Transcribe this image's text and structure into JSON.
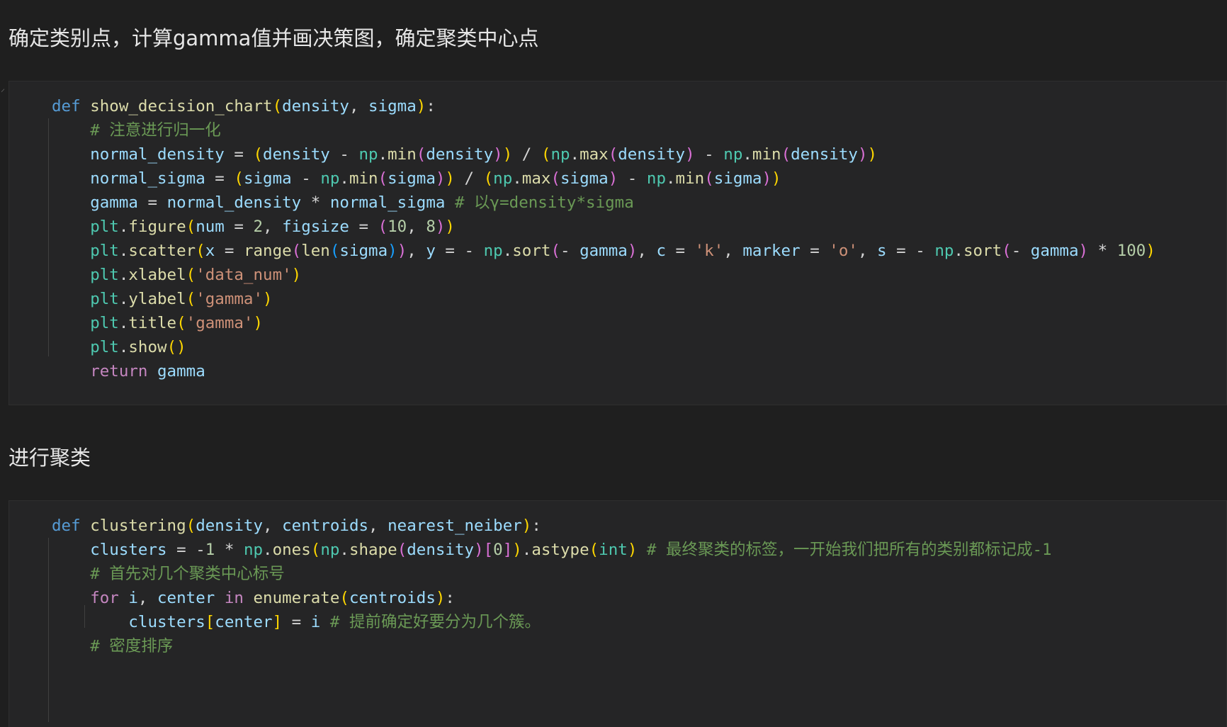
{
  "headings": {
    "first": "确定类别点，计算gamma值并画决策图，确定聚类中心点",
    "second": "进行聚类"
  },
  "cell1": {
    "lines": [
      [
        [
          "kw",
          "def"
        ],
        [
          "op",
          " "
        ],
        [
          "fn",
          "show_decision_chart"
        ],
        [
          "b1",
          "("
        ],
        [
          "var",
          "density"
        ],
        [
          "op",
          ", "
        ],
        [
          "var",
          "sigma"
        ],
        [
          "b1",
          ")"
        ],
        [
          "op",
          ":"
        ]
      ],
      [
        [
          "op",
          "    "
        ],
        [
          "cm",
          "# 注意进行归一化"
        ]
      ],
      [
        [
          "op",
          "    "
        ],
        [
          "var",
          "normal_density"
        ],
        [
          "op",
          " = "
        ],
        [
          "b1",
          "("
        ],
        [
          "var",
          "density"
        ],
        [
          "op",
          " - "
        ],
        [
          "mod",
          "np"
        ],
        [
          "op",
          "."
        ],
        [
          "fn",
          "min"
        ],
        [
          "b2",
          "("
        ],
        [
          "var",
          "density"
        ],
        [
          "b2",
          ")"
        ],
        [
          "b1",
          ")"
        ],
        [
          "op",
          " / "
        ],
        [
          "b1",
          "("
        ],
        [
          "mod",
          "np"
        ],
        [
          "op",
          "."
        ],
        [
          "fn",
          "max"
        ],
        [
          "b2",
          "("
        ],
        [
          "var",
          "density"
        ],
        [
          "b2",
          ")"
        ],
        [
          "op",
          " - "
        ],
        [
          "mod",
          "np"
        ],
        [
          "op",
          "."
        ],
        [
          "fn",
          "min"
        ],
        [
          "b2",
          "("
        ],
        [
          "var",
          "density"
        ],
        [
          "b2",
          ")"
        ],
        [
          "b1",
          ")"
        ]
      ],
      [
        [
          "op",
          "    "
        ],
        [
          "var",
          "normal_sigma"
        ],
        [
          "op",
          " = "
        ],
        [
          "b1",
          "("
        ],
        [
          "var",
          "sigma"
        ],
        [
          "op",
          " - "
        ],
        [
          "mod",
          "np"
        ],
        [
          "op",
          "."
        ],
        [
          "fn",
          "min"
        ],
        [
          "b2",
          "("
        ],
        [
          "var",
          "sigma"
        ],
        [
          "b2",
          ")"
        ],
        [
          "b1",
          ")"
        ],
        [
          "op",
          " / "
        ],
        [
          "b1",
          "("
        ],
        [
          "mod",
          "np"
        ],
        [
          "op",
          "."
        ],
        [
          "fn",
          "max"
        ],
        [
          "b2",
          "("
        ],
        [
          "var",
          "sigma"
        ],
        [
          "b2",
          ")"
        ],
        [
          "op",
          " - "
        ],
        [
          "mod",
          "np"
        ],
        [
          "op",
          "."
        ],
        [
          "fn",
          "min"
        ],
        [
          "b2",
          "("
        ],
        [
          "var",
          "sigma"
        ],
        [
          "b2",
          ")"
        ],
        [
          "b1",
          ")"
        ]
      ],
      [
        [
          "op",
          "    "
        ],
        [
          "var",
          "gamma"
        ],
        [
          "op",
          " = "
        ],
        [
          "var",
          "normal_density"
        ],
        [
          "op",
          " * "
        ],
        [
          "var",
          "normal_sigma"
        ],
        [
          "op",
          " "
        ],
        [
          "cm",
          "# 以γ=density*sigma"
        ]
      ],
      [
        [
          "op",
          "    "
        ],
        [
          "mod",
          "plt"
        ],
        [
          "op",
          "."
        ],
        [
          "fn",
          "figure"
        ],
        [
          "b1",
          "("
        ],
        [
          "var",
          "num"
        ],
        [
          "op",
          " = "
        ],
        [
          "num",
          "2"
        ],
        [
          "op",
          ", "
        ],
        [
          "var",
          "figsize"
        ],
        [
          "op",
          " = "
        ],
        [
          "b2",
          "("
        ],
        [
          "num",
          "10"
        ],
        [
          "op",
          ", "
        ],
        [
          "num",
          "8"
        ],
        [
          "b2",
          ")"
        ],
        [
          "b1",
          ")"
        ]
      ],
      [
        [
          "op",
          "    "
        ],
        [
          "mod",
          "plt"
        ],
        [
          "op",
          "."
        ],
        [
          "fn",
          "scatter"
        ],
        [
          "b1",
          "("
        ],
        [
          "var",
          "x"
        ],
        [
          "op",
          " = "
        ],
        [
          "fn",
          "range"
        ],
        [
          "b2",
          "("
        ],
        [
          "fn",
          "len"
        ],
        [
          "b3",
          "("
        ],
        [
          "var",
          "sigma"
        ],
        [
          "b3",
          ")"
        ],
        [
          "b2",
          ")"
        ],
        [
          "op",
          ", "
        ],
        [
          "var",
          "y"
        ],
        [
          "op",
          " = - "
        ],
        [
          "mod",
          "np"
        ],
        [
          "op",
          "."
        ],
        [
          "fn",
          "sort"
        ],
        [
          "b2",
          "("
        ],
        [
          "op",
          "- "
        ],
        [
          "var",
          "gamma"
        ],
        [
          "b2",
          ")"
        ],
        [
          "op",
          ", "
        ],
        [
          "var",
          "c"
        ],
        [
          "op",
          " = "
        ],
        [
          "str",
          "'k'"
        ],
        [
          "op",
          ", "
        ],
        [
          "var",
          "marker"
        ],
        [
          "op",
          " = "
        ],
        [
          "str",
          "'o'"
        ],
        [
          "op",
          ", "
        ],
        [
          "var",
          "s"
        ],
        [
          "op",
          " = - "
        ],
        [
          "mod",
          "np"
        ],
        [
          "op",
          "."
        ],
        [
          "fn",
          "sort"
        ],
        [
          "b2",
          "("
        ],
        [
          "op",
          "- "
        ],
        [
          "var",
          "gamma"
        ],
        [
          "b2",
          ")"
        ],
        [
          "op",
          " * "
        ],
        [
          "num",
          "100"
        ],
        [
          "b1",
          ")"
        ]
      ],
      [
        [
          "op",
          "    "
        ],
        [
          "mod",
          "plt"
        ],
        [
          "op",
          "."
        ],
        [
          "fn",
          "xlabel"
        ],
        [
          "b1",
          "("
        ],
        [
          "str",
          "'data_num'"
        ],
        [
          "b1",
          ")"
        ]
      ],
      [
        [
          "op",
          "    "
        ],
        [
          "mod",
          "plt"
        ],
        [
          "op",
          "."
        ],
        [
          "fn",
          "ylabel"
        ],
        [
          "b1",
          "("
        ],
        [
          "str",
          "'gamma'"
        ],
        [
          "b1",
          ")"
        ]
      ],
      [
        [
          "op",
          "    "
        ],
        [
          "mod",
          "plt"
        ],
        [
          "op",
          "."
        ],
        [
          "fn",
          "title"
        ],
        [
          "b1",
          "("
        ],
        [
          "str",
          "'gamma'"
        ],
        [
          "b1",
          ")"
        ]
      ],
      [
        [
          "op",
          "    "
        ],
        [
          "mod",
          "plt"
        ],
        [
          "op",
          "."
        ],
        [
          "fn",
          "show"
        ],
        [
          "b1",
          "()"
        ]
      ],
      [
        [
          "op",
          "    "
        ],
        [
          "kw2",
          "return"
        ],
        [
          "op",
          " "
        ],
        [
          "var",
          "gamma"
        ]
      ]
    ]
  },
  "cell2": {
    "lines": [
      [
        [
          "kw",
          "def"
        ],
        [
          "op",
          " "
        ],
        [
          "fn",
          "clustering"
        ],
        [
          "b1",
          "("
        ],
        [
          "var",
          "density"
        ],
        [
          "op",
          ", "
        ],
        [
          "var",
          "centroids"
        ],
        [
          "op",
          ", "
        ],
        [
          "var",
          "nearest_neiber"
        ],
        [
          "b1",
          ")"
        ],
        [
          "op",
          ":"
        ]
      ],
      [
        [
          "op",
          "    "
        ],
        [
          "var",
          "clusters"
        ],
        [
          "op",
          " = "
        ],
        [
          "op",
          "-"
        ],
        [
          "num",
          "1"
        ],
        [
          "op",
          " * "
        ],
        [
          "mod",
          "np"
        ],
        [
          "op",
          "."
        ],
        [
          "fn",
          "ones"
        ],
        [
          "b1",
          "("
        ],
        [
          "mod",
          "np"
        ],
        [
          "op",
          "."
        ],
        [
          "fn",
          "shape"
        ],
        [
          "b2",
          "("
        ],
        [
          "var",
          "density"
        ],
        [
          "b2",
          ")"
        ],
        [
          "b2",
          "["
        ],
        [
          "num",
          "0"
        ],
        [
          "b2",
          "]"
        ],
        [
          "b1",
          ")"
        ],
        [
          "op",
          "."
        ],
        [
          "fn",
          "astype"
        ],
        [
          "b1",
          "("
        ],
        [
          "bi",
          "int"
        ],
        [
          "b1",
          ")"
        ],
        [
          "op",
          " "
        ],
        [
          "cm",
          "# 最终聚类的标签，一开始我们把所有的类别都标记成-1"
        ]
      ],
      [
        [
          "op",
          "    "
        ],
        [
          "cm",
          "# 首先对几个聚类中心标号"
        ]
      ],
      [
        [
          "op",
          "    "
        ],
        [
          "kw2",
          "for"
        ],
        [
          "op",
          " "
        ],
        [
          "var",
          "i"
        ],
        [
          "op",
          ", "
        ],
        [
          "var",
          "center"
        ],
        [
          "op",
          " "
        ],
        [
          "kw2",
          "in"
        ],
        [
          "op",
          " "
        ],
        [
          "fn",
          "enumerate"
        ],
        [
          "b1",
          "("
        ],
        [
          "var",
          "centroids"
        ],
        [
          "b1",
          ")"
        ],
        [
          "op",
          ":"
        ]
      ],
      [
        [
          "op",
          "        "
        ],
        [
          "var",
          "clusters"
        ],
        [
          "b1",
          "["
        ],
        [
          "var",
          "center"
        ],
        [
          "b1",
          "]"
        ],
        [
          "op",
          " = "
        ],
        [
          "var",
          "i"
        ],
        [
          "op",
          " "
        ],
        [
          "cm",
          "# 提前确定好要分为几个簇。"
        ]
      ],
      [
        [
          "op",
          "    "
        ],
        [
          "cm",
          "# 密度排序"
        ]
      ]
    ]
  }
}
